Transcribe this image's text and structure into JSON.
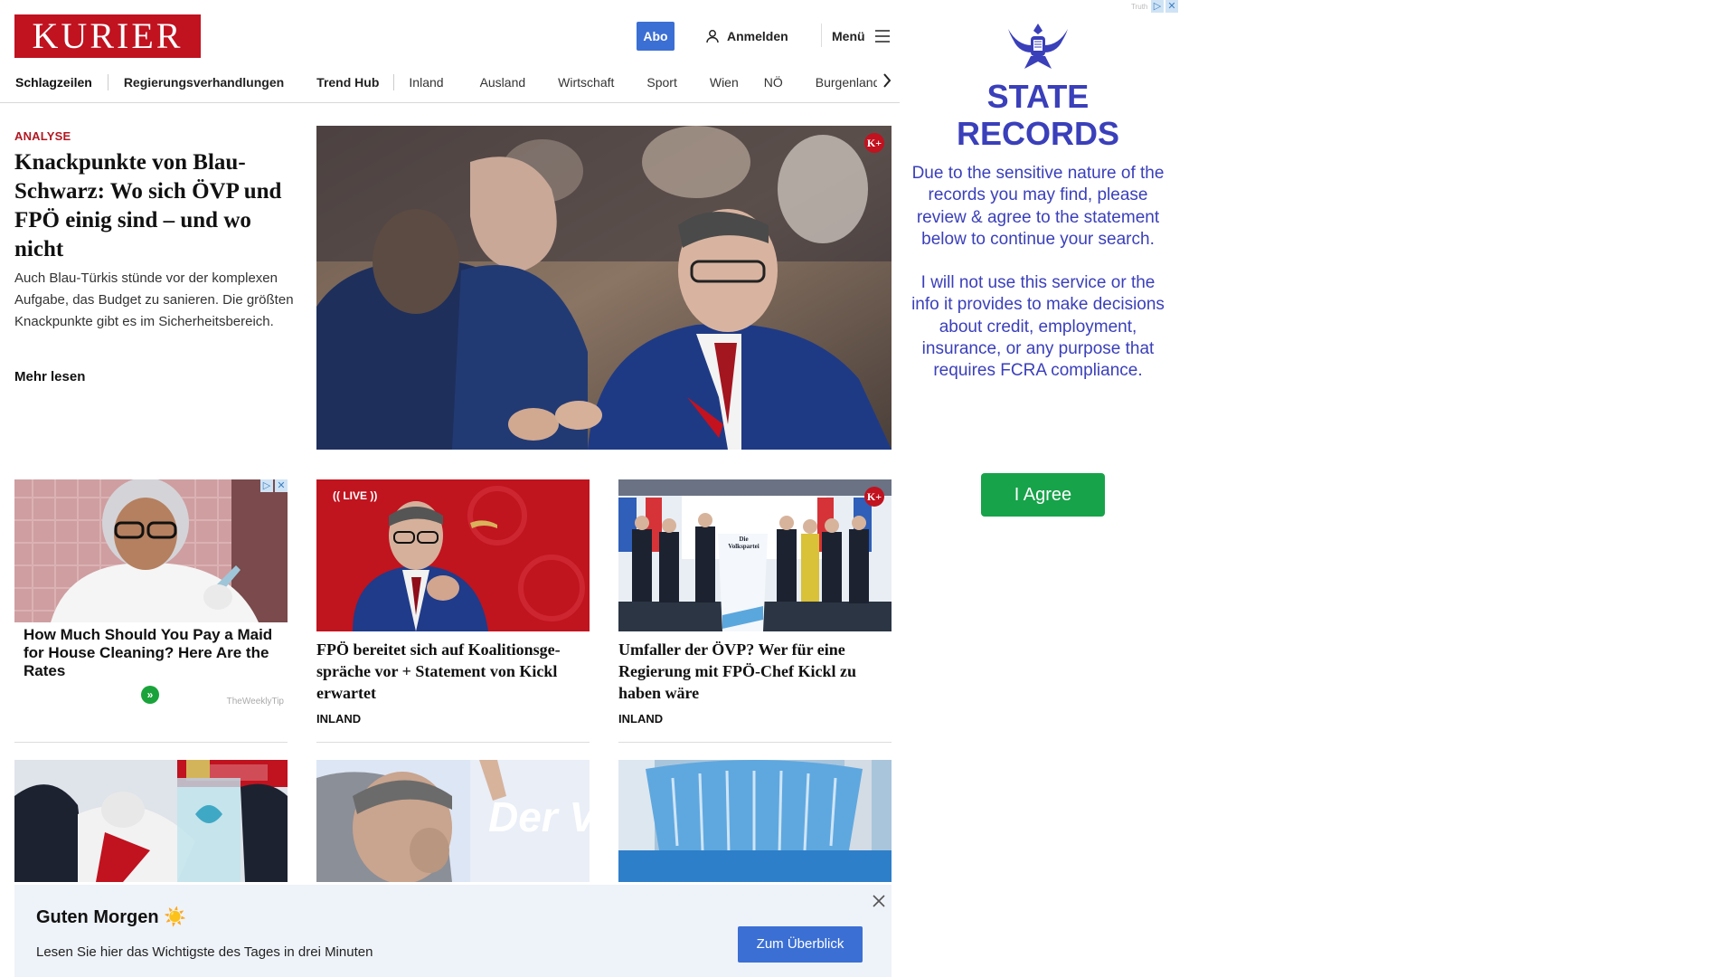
{
  "header": {
    "logo": "KURIER",
    "abo_label": "Abo",
    "login_label": "Anmelden",
    "menu_label": "Menü"
  },
  "nav": {
    "items": [
      "Schlagzeilen",
      "Regierungsverhandlungen",
      "Trend Hub",
      "Inland",
      "Ausland",
      "Wirtschaft",
      "Sport",
      "Wien",
      "NÖ",
      "Burgenland"
    ]
  },
  "hero": {
    "kicker": "ANALYSE",
    "title": "Knackpunkte von Blau-Schwarz: Wo sich ÖVP und FPÖ einig sind – und wo nicht",
    "teaser": "Auch Blau-Türkis stünde vor der komplexen Aufgabe, das Budget zu sanieren. Die größten Knackpunkte gibt es im Sicherheitsbereich.",
    "more_label": "Mehr lesen",
    "badge": "K+"
  },
  "ad_card": {
    "title": "How Much Should You Pay a Maid for House Cleaning? Here Are the Rates",
    "source": "TheWeeklyTip"
  },
  "cards": [
    {
      "live_label": "LIVE",
      "title": "FPÖ bereitet sich auf Koalitionsge­spräche vor + Statement von Kickl erwartet",
      "category": "INLAND"
    },
    {
      "badge": "K+",
      "podium_text": "Die Volkspartei",
      "title": "Umfaller der ÖVP? Wer für eine Regierung mit FPÖ-Chef Kickl zu haben wäre",
      "category": "INLAND"
    }
  ],
  "row2": {
    "poster_text": "Der Verd"
  },
  "side_ad": {
    "brand": "Truth",
    "heading_line1": "STATE",
    "heading_line2": "RECORDS",
    "text1": "Due to the sensitive nature of the records you may find, please review & agree to the statement below to continue your search.",
    "text2": "I will not use this service or the info it provides to make decisions about credit, employment, insurance, or any purpose that requires FCRA compliance.",
    "agree_label": "I Agree"
  },
  "banner": {
    "title": "Guten Morgen ☀️",
    "subtitle": "Lesen Sie hier das Wichtigste des Tages in drei Minuten",
    "button_label": "Zum Überblick"
  },
  "colors": {
    "brand_red": "#c1121f",
    "accent_blue": "#3b6fd4",
    "ad_blue": "#3a3fba",
    "ad_green": "#17a34a"
  }
}
